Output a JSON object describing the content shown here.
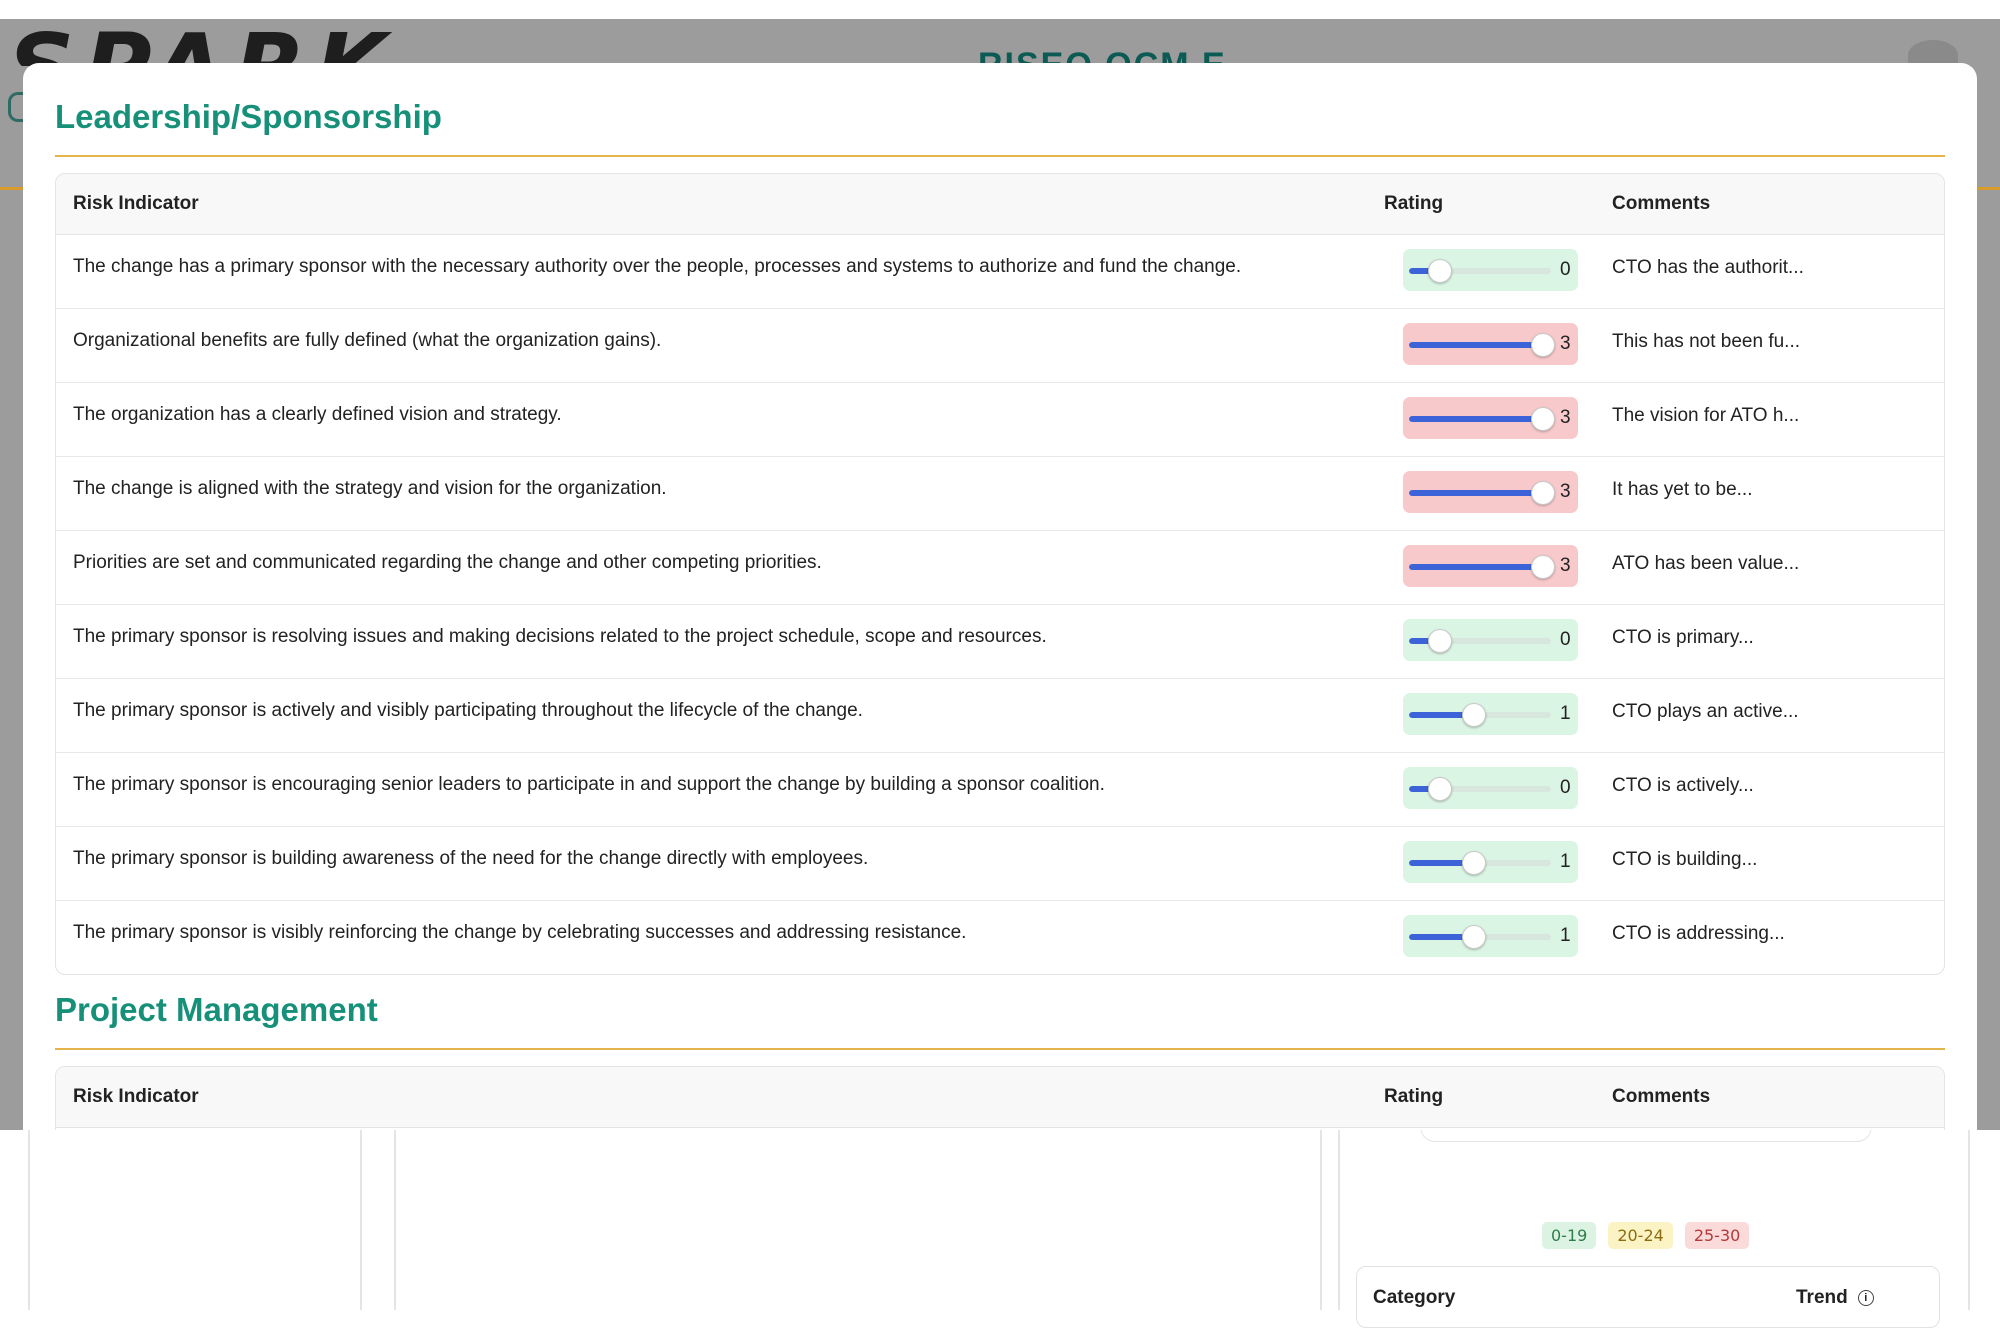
{
  "background": {
    "logo_text": "SPARK",
    "header_title": "RISEO OCM E",
    "legend": [
      "0-19",
      "20-24",
      "25-30"
    ],
    "category_header": "Category",
    "trend_header": "Trend",
    "info_icon": "i"
  },
  "modal": {
    "sections": [
      {
        "title": "Leadership/Sponsorship",
        "headers": {
          "risk": "Risk Indicator",
          "rating": "Rating",
          "comments": "Comments"
        },
        "rows": [
          {
            "risk": "The change has a primary sponsor with the necessary authority over the people, processes and systems to authorize and fund the change.",
            "rating": 0,
            "rating_level": "green",
            "comment": "CTO has the authorit..."
          },
          {
            "risk": "Organizational benefits are fully defined (what the organization gains).",
            "rating": 3,
            "rating_level": "red",
            "comment": "This has not been fu..."
          },
          {
            "risk": "The organization has a clearly defined vision and strategy.",
            "rating": 3,
            "rating_level": "red",
            "comment": "The vision for ATO h..."
          },
          {
            "risk": "The change is aligned with the strategy and vision for the organization.",
            "rating": 3,
            "rating_level": "red",
            "comment": "It has yet to be..."
          },
          {
            "risk": "Priorities are set and communicated regarding the change and other competing priorities.",
            "rating": 3,
            "rating_level": "red",
            "comment": "ATO has been value..."
          },
          {
            "risk": "The primary sponsor is resolving issues and making decisions related to the project schedule, scope and resources.",
            "rating": 0,
            "rating_level": "green",
            "comment": "CTO is primary..."
          },
          {
            "risk": "The primary sponsor is actively and visibly participating throughout the lifecycle of the change.",
            "rating": 1,
            "rating_level": "green",
            "comment": "CTO plays an active..."
          },
          {
            "risk": "The primary sponsor is encouraging senior leaders to participate in and support the change by building a sponsor coalition.",
            "rating": 0,
            "rating_level": "green",
            "comment": "CTO is actively..."
          },
          {
            "risk": "The primary sponsor is building awareness of the need for the change directly with employees.",
            "rating": 1,
            "rating_level": "green",
            "comment": "CTO is building..."
          },
          {
            "risk": "The primary sponsor is visibly reinforcing the change by celebrating successes and addressing resistance.",
            "rating": 1,
            "rating_level": "green",
            "comment": "CTO is addressing..."
          }
        ]
      },
      {
        "title": "Project Management",
        "headers": {
          "risk": "Risk Indicator",
          "rating": "Rating",
          "comments": "Comments"
        },
        "rows": []
      }
    ]
  },
  "colors": {
    "section_title": "#17907a",
    "rule": "#e4b54a",
    "slider_fill": "#3d63d8",
    "rating_green_bg": "#dbf5e4",
    "rating_red_bg": "#f8c9cb"
  }
}
